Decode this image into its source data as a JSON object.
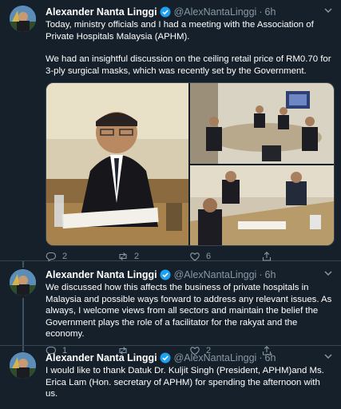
{
  "tweets": [
    {
      "author": "Alexander Nanta Linggi",
      "handle": "@AlexNantaLinggi",
      "separator": "·",
      "time": "6h",
      "paragraphs": [
        "Today, ministry officials and I had a meeting with the Association of Private Hospitals Malaysia (APHM).",
        "We had an insightful discussion on the ceiling retail price of RM0.70 for 3-ply surgical masks, which was recently set by the Government."
      ],
      "counts": {
        "reply": "2",
        "retweet": "2",
        "like": "6"
      }
    },
    {
      "author": "Alexander Nanta Linggi",
      "handle": "@AlexNantaLinggi",
      "separator": "·",
      "time": "6h",
      "paragraphs": [
        "We discussed how this affects the business of private hospitals in Malaysia and possible ways forward to address any relevant issues. As always, I welcome views from all sectors and maintain the belief the Government plays the role of a facilitator for the rakyat and the economy."
      ],
      "counts": {
        "reply": "1",
        "retweet": "",
        "like": "2"
      }
    },
    {
      "author": "Alexander Nanta Linggi",
      "handle": "@AlexNantaLinggi",
      "separator": "·",
      "time": "6h",
      "paragraphs": [
        "I would like to thank Datuk Dr. Kuljit Singh (President, APHM)and Ms. Erica Lam (Hon. secretary of APHM) for spending the afternoon with us."
      ],
      "counts": {
        "reply": "",
        "retweet": "",
        "like": ""
      }
    }
  ],
  "colors": {
    "background": "#15202b",
    "text": "#ffffff",
    "secondary": "#8899a6",
    "verified": "#1da1f2",
    "border": "#38444d"
  },
  "icons": [
    "verified-badge-icon",
    "chevron-down-icon",
    "reply-icon",
    "retweet-icon",
    "like-icon",
    "share-icon"
  ]
}
